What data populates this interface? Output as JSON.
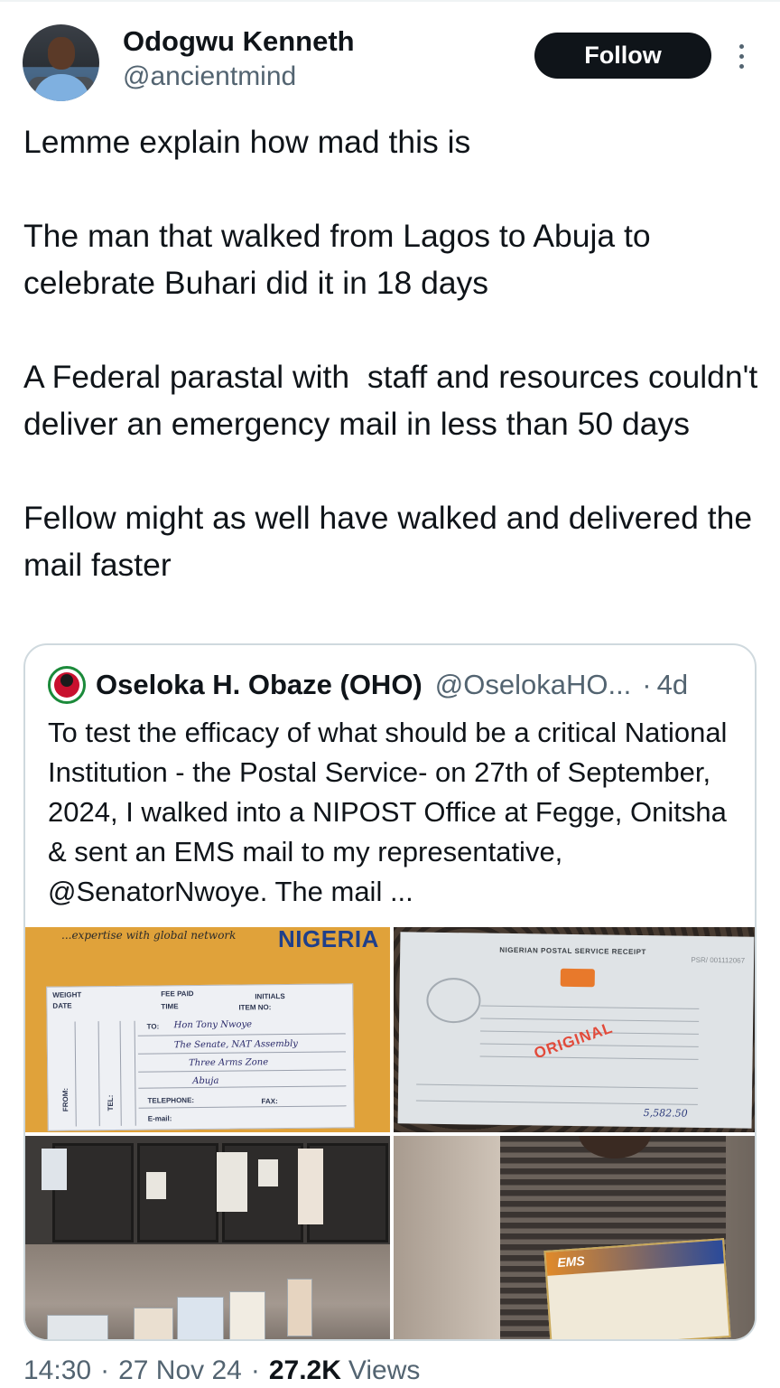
{
  "author": {
    "display_name": "Odogwu Kenneth",
    "handle": "@ancientmind"
  },
  "header": {
    "follow_label": "Follow",
    "more_icon": "more-vertical-icon"
  },
  "tweet": {
    "paragraphs": [
      "Lemme explain how mad this is",
      "The man that walked from Lagos to Abuja to celebrate Buhari did it in 18 days",
      "A Federal parastal with  staff and resources couldn't deliver an emergency mail in less than 50 days",
      "Fellow might as well have walked and delivered the mail faster"
    ]
  },
  "quote": {
    "display_name": "Oseloka H. Obaze (OHO)",
    "handle": "@OselokaHO...",
    "dot": "·",
    "time": "4d",
    "text": "To test the efficacy of what should be a critical National Institution - the Postal Service- on 27th of September, 2024, I walked into a NIPOST Office at Fegge, Onitsha & sent an EMS mail to my representative,  @SenatorNwoye.  The mail ...",
    "media": {
      "envelope": {
        "tagline": "...expertise with global network",
        "brand": "NIGERIA",
        "fields": [
          "WEIGHT",
          "DATE",
          "FEE PAID",
          "TIME",
          "INITIALS",
          "ITEM NO:",
          "TO:",
          "TELEPHONE:",
          "FAX:",
          "E-mail:",
          "FROM:",
          "TEL:"
        ],
        "handwriting": [
          "Hon Tony Nwoye",
          "The Senate, NAT Assembly",
          "Three Arms Zone",
          "Abuja"
        ]
      },
      "receipt": {
        "title": "NIGERIAN POSTAL SERVICE RECEIPT",
        "number": "PSR/ 001112067",
        "stamp_text": "ORIGINAL",
        "amount": "5,582.50"
      },
      "package": {
        "label": "EMS"
      }
    }
  },
  "footer": {
    "time": "14:30",
    "date": "27 Nov 24",
    "views_count": "27.2K",
    "views_label": "Views",
    "separator": "·"
  }
}
